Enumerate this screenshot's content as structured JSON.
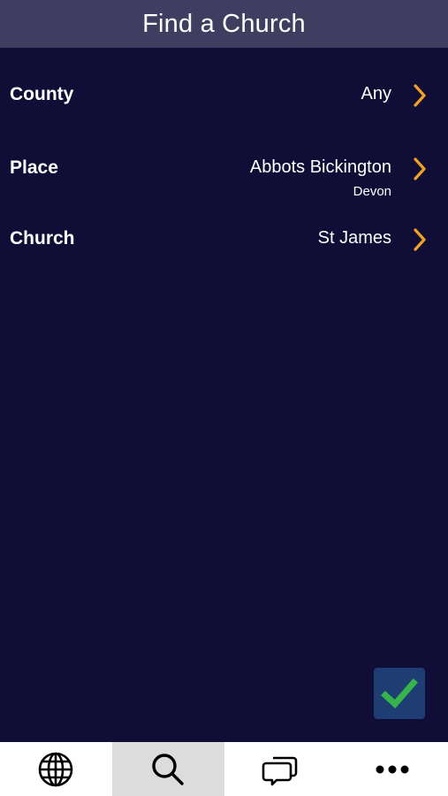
{
  "header": {
    "title": "Find a Church"
  },
  "rows": [
    {
      "label": "County",
      "value": "Any"
    },
    {
      "label": "Place",
      "value": "Abbots Bickington",
      "subvalue": "Devon"
    },
    {
      "label": "Church",
      "value": "St James"
    }
  ],
  "colors": {
    "background": "#100d36",
    "header": "#3f3d60",
    "chevron": "#f4a024",
    "confirm_bg": "#1e3d72",
    "confirm_check": "#36b34a",
    "tabbar": "#ffffff",
    "tab_active": "#dcdcdc"
  },
  "tabbar": {
    "tabs": [
      {
        "icon": "globe-icon",
        "active": false
      },
      {
        "icon": "search-icon",
        "active": true
      },
      {
        "icon": "chat-bubbles-icon",
        "active": false
      },
      {
        "icon": "more-dots-icon",
        "active": false
      }
    ]
  },
  "confirm_icon": "checkmark-icon"
}
